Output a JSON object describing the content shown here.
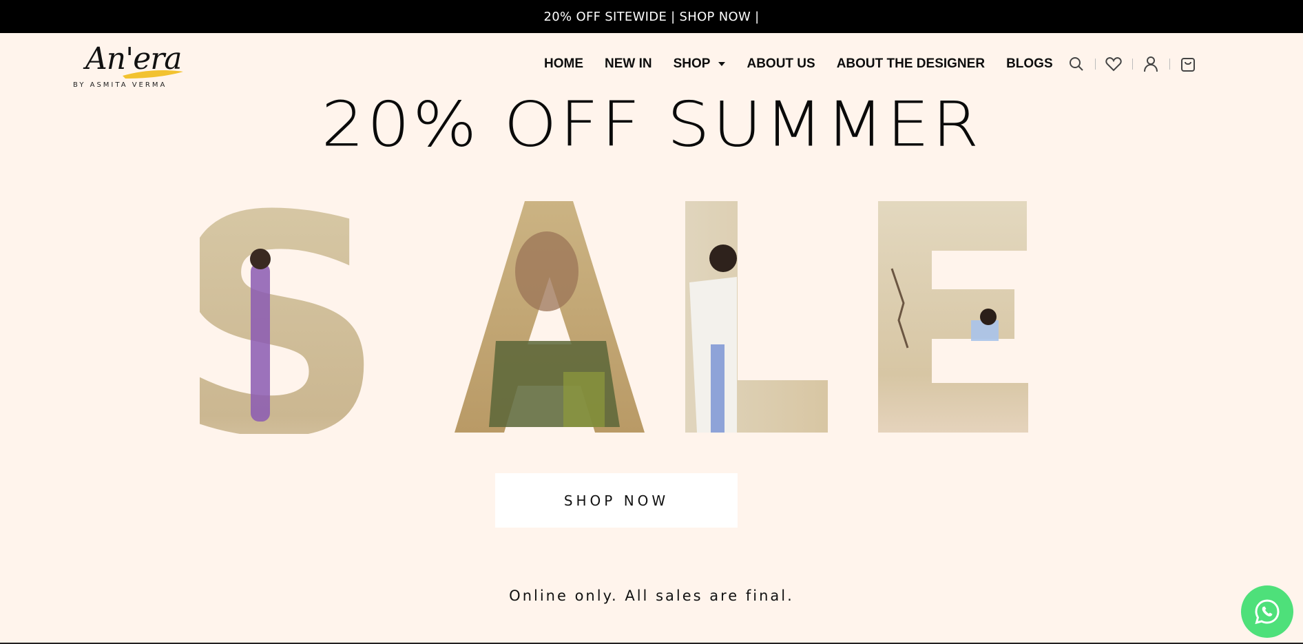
{
  "announcement": {
    "text": "20% OFF SITEWIDE | SHOP NOW |"
  },
  "brand": {
    "script": "An'era",
    "sub": "BY ASMITA VERMA"
  },
  "nav": {
    "home": "HOME",
    "new_in": "NEW IN",
    "shop": "SHOP",
    "about_us": "ABOUT US",
    "about_designer": "ABOUT THE DESIGNER",
    "blogs": "BLOGS"
  },
  "icons": [
    "search-icon",
    "heart-icon",
    "user-icon",
    "cart-icon"
  ],
  "hero": {
    "headline": "20% OFF SUMMER",
    "sale_letters": [
      "S",
      "A",
      "L",
      "E"
    ],
    "button": "SHOP NOW",
    "note": "Online only. All sales are final."
  },
  "colors": {
    "background": "#fff4ec",
    "announcement_bg": "#000000",
    "whatsapp": "#4ee07a",
    "logo_swash": "#f2c230"
  }
}
